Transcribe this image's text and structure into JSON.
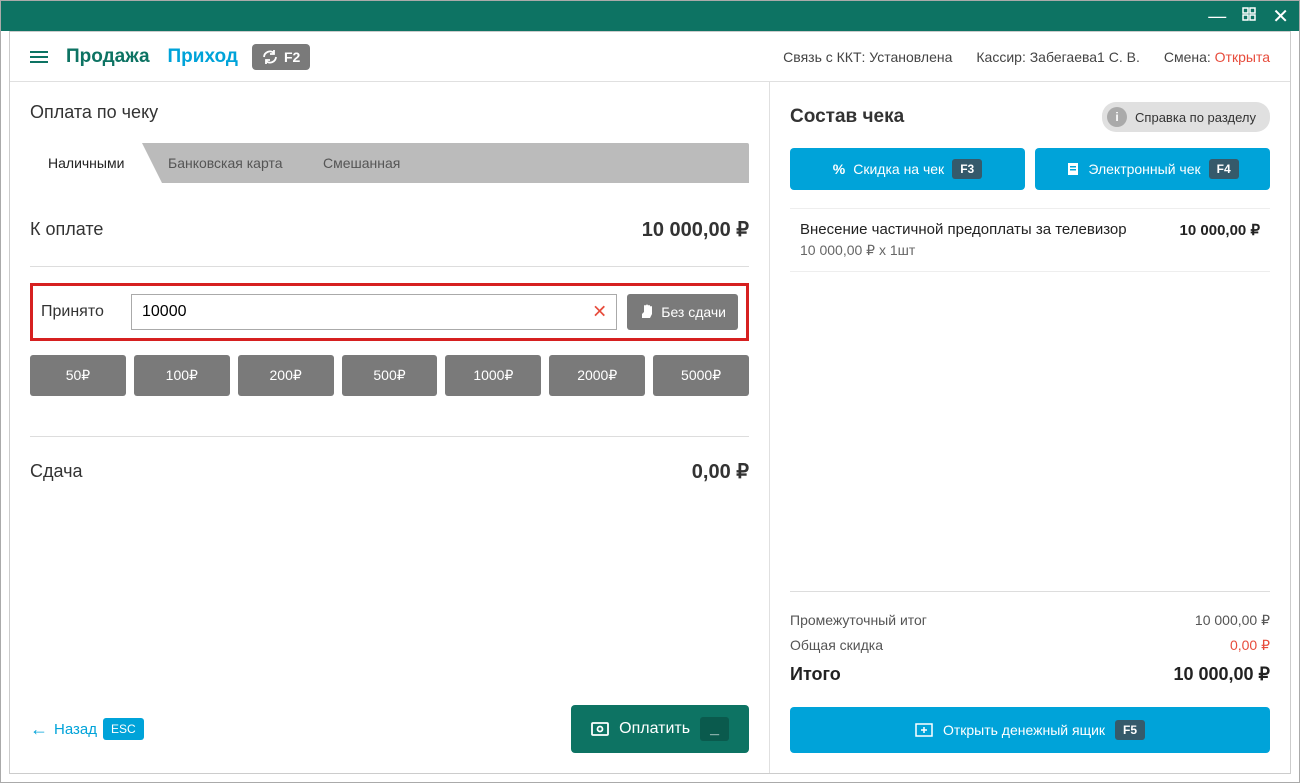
{
  "topbar": {
    "sale": "Продажа",
    "income": "Приход",
    "f2": "F2",
    "kkt_label": "Связь с ККТ: Установлена",
    "cashier_label": "Кассир: Забегаева1 С. В.",
    "shift_label": "Смена: ",
    "shift_status": "Открыта"
  },
  "left": {
    "title": "Оплата по чеку",
    "tabs": {
      "cash": "Наличными",
      "card": "Банковская карта",
      "mixed": "Смешанная"
    },
    "to_pay_label": "К оплате",
    "to_pay_value": "10 000,00 ₽",
    "accepted_label": "Принято",
    "accepted_value": "10000",
    "no_change": "Без  сдачи",
    "denoms": [
      "50₽",
      "100₽",
      "200₽",
      "500₽",
      "1000₽",
      "2000₽",
      "5000₽"
    ],
    "change_label": "Сдача",
    "change_value": "0,00 ₽",
    "back": "Назад",
    "esc": "ESC",
    "pay": "Оплатить",
    "pay_key": "_"
  },
  "right": {
    "title": "Состав чека",
    "help": "Справка по разделу",
    "discount_btn": "Скидка на чек",
    "discount_key": "F3",
    "echeck_btn": "Электронный чек",
    "echeck_key": "F4",
    "item_name": "Внесение частичной предоплаты за телевизор",
    "item_qty": "10 000,00 ₽ х 1шт",
    "item_total": "10 000,00 ₽",
    "subtotal_label": "Промежуточный итог",
    "subtotal_value": "10 000,00 ₽",
    "discount_label": "Общая скидка",
    "discount_value": "0,00 ₽",
    "total_label": "Итого",
    "total_value": "10 000,00 ₽",
    "drawer_btn": "Открыть денежный ящик",
    "drawer_key": "F5"
  }
}
